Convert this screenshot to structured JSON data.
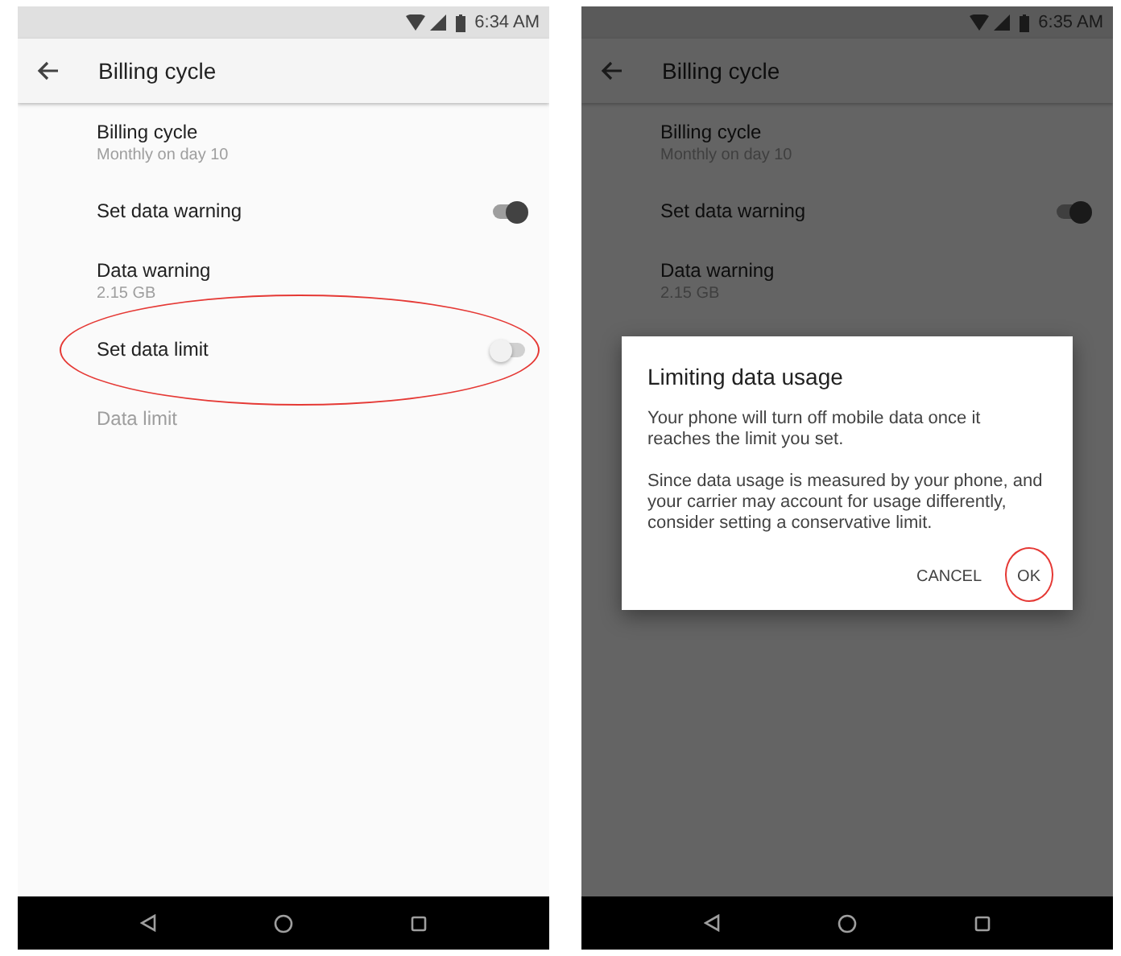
{
  "screens": [
    {
      "status_bar": {
        "time": "6:34 AM"
      },
      "app_bar": {
        "title": "Billing cycle"
      },
      "dimmed": false,
      "settings": [
        {
          "kind": "text",
          "title": "Billing cycle",
          "summary": "Monthly on day 10",
          "disabled": false,
          "circled": false
        },
        {
          "kind": "switch",
          "title": "Set data warning",
          "on": true,
          "circled": false
        },
        {
          "kind": "text",
          "title": "Data warning",
          "summary": "2.15 GB",
          "disabled": false,
          "circled": false
        },
        {
          "kind": "switch",
          "title": "Set data limit",
          "on": false,
          "circled": true
        },
        {
          "kind": "text",
          "title": "Data limit",
          "disabled": true,
          "circled": false
        }
      ]
    },
    {
      "status_bar": {
        "time": "6:35 AM"
      },
      "app_bar": {
        "title": "Billing cycle"
      },
      "dimmed": true,
      "settings": [
        {
          "kind": "text",
          "title": "Billing cycle",
          "summary": "Monthly on day 10",
          "disabled": false,
          "circled": false
        },
        {
          "kind": "switch",
          "title": "Set data warning",
          "on": true,
          "circled": false
        },
        {
          "kind": "text",
          "title": "Data warning",
          "summary": "2.15 GB",
          "disabled": false,
          "circled": false
        }
      ],
      "dialog": {
        "title": "Limiting data usage",
        "paragraphs": [
          "Your phone will turn off mobile data once it reaches the limit you set.",
          "Since data usage is measured by your phone, and your carrier may account for usage differently, consider setting a conservative limit."
        ],
        "buttons": [
          {
            "label": "CANCEL",
            "circled": false
          },
          {
            "label": "OK",
            "circled": true
          }
        ]
      }
    }
  ]
}
